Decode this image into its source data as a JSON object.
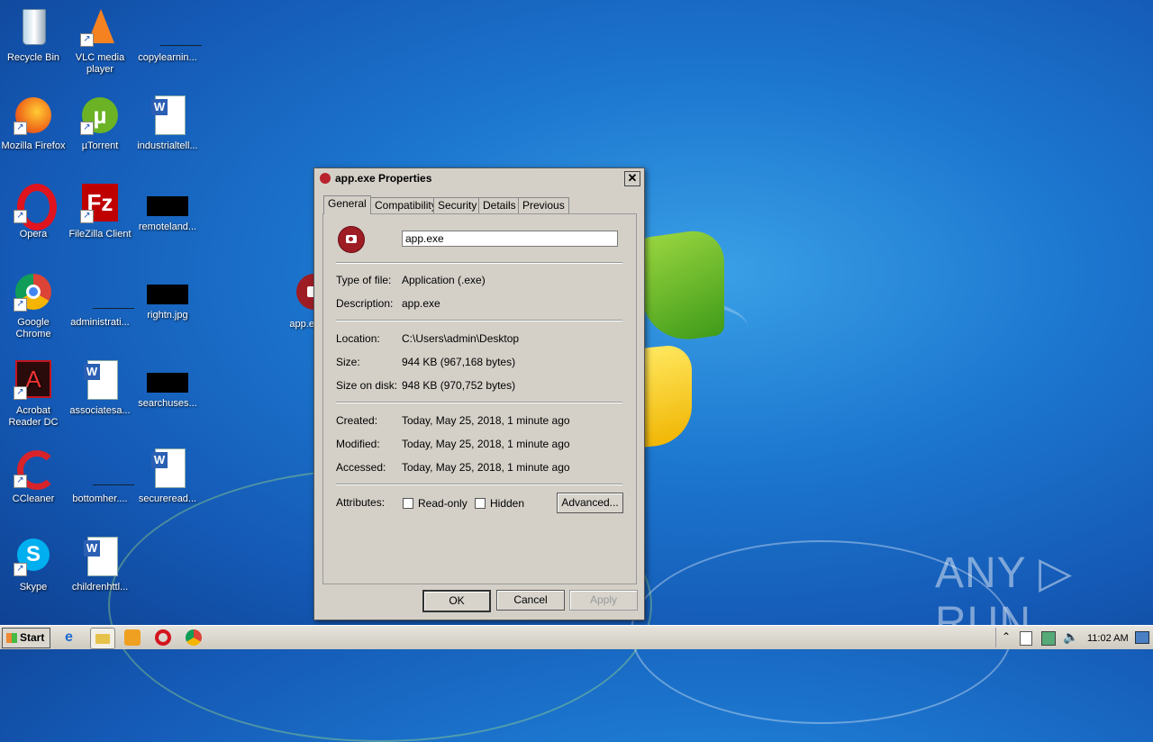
{
  "desktop": {
    "icons": [
      {
        "label": "Recycle Bin"
      },
      {
        "label": "VLC media player"
      },
      {
        "label": "copylearnin..."
      },
      {
        "label": "Mozilla Firefox"
      },
      {
        "label": "µTorrent"
      },
      {
        "label": "industrialtell..."
      },
      {
        "label": "Opera"
      },
      {
        "label": "FileZilla Client"
      },
      {
        "label": "remoteland..."
      },
      {
        "label": "Google Chrome"
      },
      {
        "label": "administrati..."
      },
      {
        "label": "rightn.jpg"
      },
      {
        "label": "app.exe"
      },
      {
        "label": "Acrobat Reader DC"
      },
      {
        "label": "associatesa..."
      },
      {
        "label": "searchuses..."
      },
      {
        "label": "CCleaner"
      },
      {
        "label": "bottomher...."
      },
      {
        "label": "secureread..."
      },
      {
        "label": "Skype"
      },
      {
        "label": "childrenhttl..."
      }
    ],
    "watermark": "ANY ▷ RUN"
  },
  "dialog": {
    "title": "app.exe Properties",
    "close_glyph": "✕",
    "tabs": [
      "General",
      "Compatibility",
      "Security",
      "Details",
      "Previous Versions"
    ],
    "filename": "app.exe",
    "type_label": "Type of file:",
    "type_value": "Application (.exe)",
    "description_label": "Description:",
    "description_value": "app.exe",
    "location_label": "Location:",
    "location_value": "C:\\Users\\admin\\Desktop",
    "size_label": "Size:",
    "size_value": "944 KB (967,168 bytes)",
    "size_on_disk_label": "Size on disk:",
    "size_on_disk_value": "948 KB (970,752 bytes)",
    "created_label": "Created:",
    "created_value": "Today, May 25, 2018, 1 minute ago",
    "modified_label": "Modified:",
    "modified_value": "Today, May 25, 2018, 1 minute ago",
    "accessed_label": "Accessed:",
    "accessed_value": "Today, May 25, 2018, 1 minute ago",
    "attributes_label": "Attributes:",
    "readonly_label": "Read-only",
    "hidden_label": "Hidden",
    "advanced_label": "Advanced...",
    "ok_label": "OK",
    "cancel_label": "Cancel",
    "apply_label": "Apply"
  },
  "taskbar": {
    "start_label": "Start",
    "clock": "11:02 AM"
  }
}
